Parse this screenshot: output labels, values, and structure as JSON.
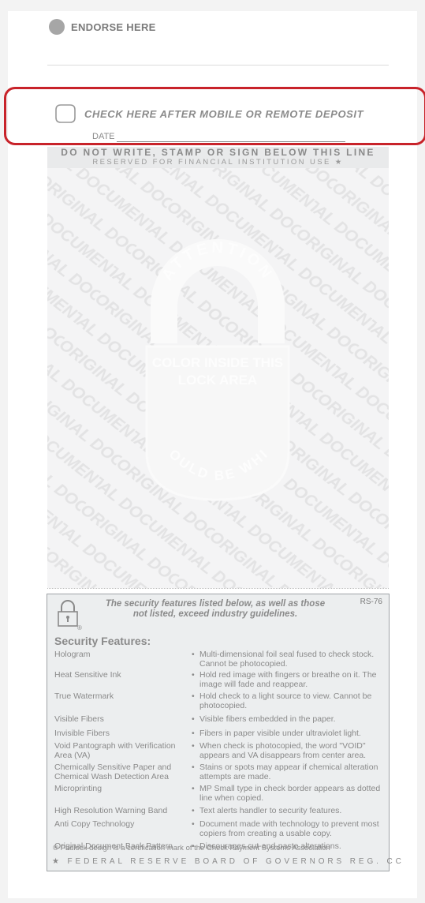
{
  "endorse": {
    "label": "ENDORSE HERE"
  },
  "deposit": {
    "label": "CHECK HERE AFTER MOBILE OR REMOTE DEPOSIT",
    "date_label": "DATE"
  },
  "restricted": {
    "line1": "DO NOT WRITE, STAMP OR SIGN BELOW THIS LINE",
    "line2": "RESERVED FOR FINANCIAL INSTITUTION USE ★"
  },
  "lock_area": {
    "attention": "ATTENTION",
    "inside": [
      "COLOR INSIDE THIS",
      "LOCK AREA"
    ],
    "bottom": "SHOULD BE WHITE",
    "pattern_word": "ORIGINAL DOCUMENT"
  },
  "security": {
    "rs_code": "RS-76",
    "intro_line1": "The security features listed below, as well as those",
    "intro_line2": "not listed, exceed industry guidelines.",
    "title": "Security Features:",
    "features": [
      {
        "name": "Hologram",
        "desc": "Multi-dimensional foil seal fused to check stock. Cannot be photocopied."
      },
      {
        "name": "Heat Sensitive Ink",
        "desc": "Hold red image with fingers or breathe on it. The image will fade and reappear."
      },
      {
        "name": "True Watermark",
        "desc": "Hold check to a light source to view. Cannot be photocopied."
      },
      {
        "name": "Visible Fibers",
        "desc": "Visible fibers embedded in the paper."
      },
      {
        "name": "Invisible Fibers",
        "desc": "Fibers in paper visible under ultraviolet light."
      },
      {
        "name": "Void Pantograph with Verification Area (VA)",
        "desc": "When check is photocopied, the word \"VOID\" appears and VA disappears from center area."
      },
      {
        "name": "Chemically Sensitive Paper and Chemical Wash Detection Area",
        "desc": "Stains or spots may appear if chemical alteration attempts are made."
      },
      {
        "name": "Microprinting",
        "desc": "MP Small type in check border appears as dotted line when copied."
      },
      {
        "name": "High Resolution Warning Band",
        "desc": "Text alerts handler to security features."
      },
      {
        "name": "Anti Copy Technology",
        "desc": "Document made with technology to prevent most copiers from creating a usable copy."
      },
      {
        "name": "Original Document Back Pattern",
        "desc": "Discourages cut-and-paste alterations."
      }
    ],
    "footnote": "® Padlock design is a certification mark of the Check Payment Systems Association",
    "federal": "★ FEDERAL RESERVE BOARD OF GOVERNORS REG. CC"
  }
}
